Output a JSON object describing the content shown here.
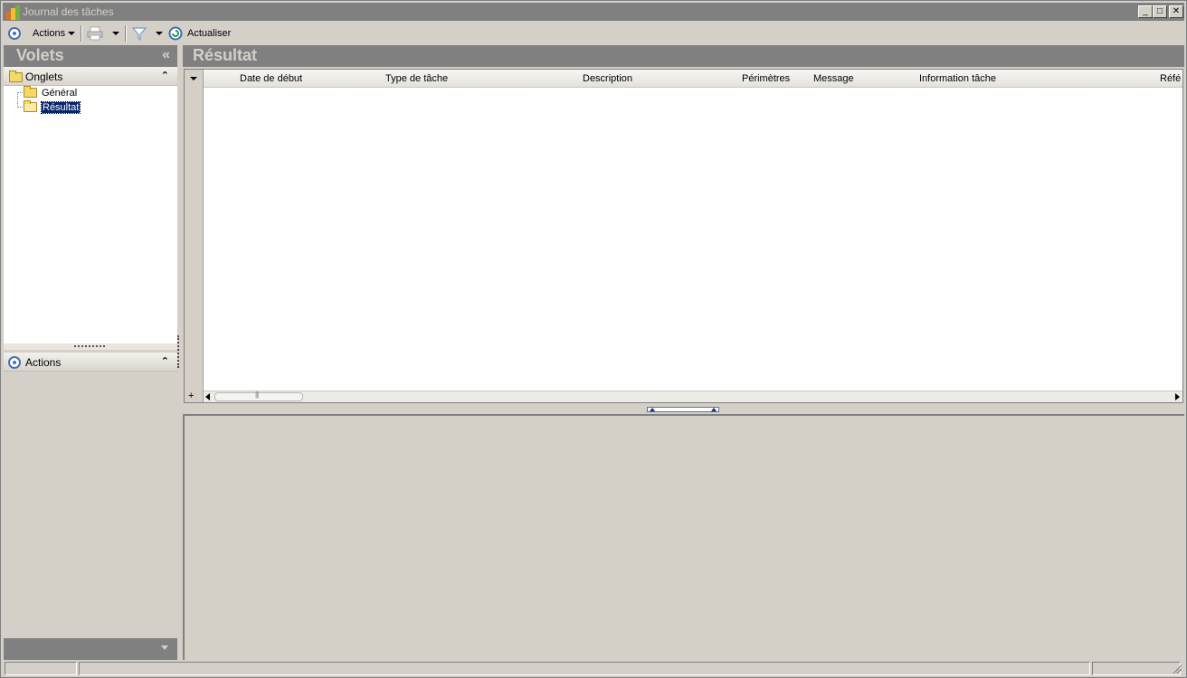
{
  "window": {
    "title": "Journal des tâches",
    "controls": [
      "minimize",
      "maximize",
      "close"
    ]
  },
  "toolbar": {
    "actions_label": "Actions",
    "refresh_label": "Actualiser"
  },
  "left_panel": {
    "title": "Volets",
    "collapse_glyph": "«",
    "tabs_section": {
      "label": "Onglets",
      "items": [
        {
          "label": "Général",
          "selected": false
        },
        {
          "label": "Résultat",
          "selected": true
        }
      ]
    },
    "actions_section": {
      "label": "Actions"
    }
  },
  "result_panel": {
    "title": "Résultat",
    "columns": [
      "Date de début",
      "Type de tâche",
      "Description",
      "Périmètres",
      "Message",
      "Information tâche",
      "Réfé"
    ]
  },
  "colors": {
    "panel_header": "#808080",
    "panel_header_text": "#d4d0c8",
    "selection": "#0a246a",
    "window_bg": "#d4d0c8"
  },
  "icons": {
    "app": "app-icon",
    "actions": "actions-icon",
    "print": "print-icon",
    "filter": "filter-icon",
    "refresh": "refresh-icon",
    "folder": "folder-icon",
    "folder_open": "folder-open-icon"
  }
}
